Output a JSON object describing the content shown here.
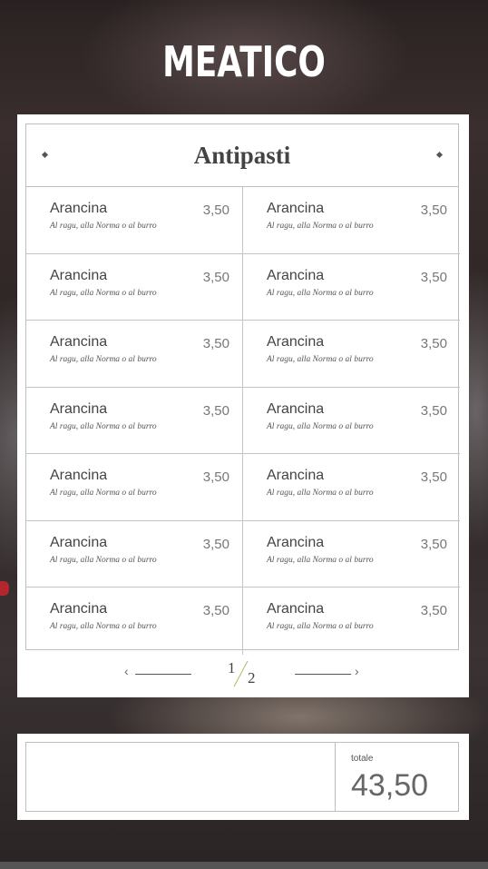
{
  "brand": {
    "logo": "MEATICO"
  },
  "menu": {
    "section_title": "Antipasti",
    "items": [
      {
        "name": "Arancina",
        "price": "3,50",
        "desc": "Al ragu, alla Norma o al burro"
      },
      {
        "name": "Arancina",
        "price": "3,50",
        "desc": "Al ragu, alla Norma o al burro"
      },
      {
        "name": "Arancina",
        "price": "3,50",
        "desc": "Al ragu, alla Norma o al burro"
      },
      {
        "name": "Arancina",
        "price": "3,50",
        "desc": "Al ragu, alla Norma o al burro"
      },
      {
        "name": "Arancina",
        "price": "3,50",
        "desc": "Al ragu, alla Norma o al burro"
      },
      {
        "name": "Arancina",
        "price": "3,50",
        "desc": "Al ragu, alla Norma o al burro"
      },
      {
        "name": "Arancina",
        "price": "3,50",
        "desc": "Al ragu, alla Norma o al burro"
      },
      {
        "name": "Arancina",
        "price": "3,50",
        "desc": "Al ragu, alla Norma o al burro"
      },
      {
        "name": "Arancina",
        "price": "3,50",
        "desc": "Al ragu, alla Norma o al burro"
      },
      {
        "name": "Arancina",
        "price": "3,50",
        "desc": "Al ragu, alla Norma o al burro"
      },
      {
        "name": "Arancina",
        "price": "3,50",
        "desc": "Al ragu, alla Norma o al burro"
      },
      {
        "name": "Arancina",
        "price": "3,50",
        "desc": "Al ragu, alla Norma o al burro"
      },
      {
        "name": "Arancina",
        "price": "3,50",
        "desc": "Al ragu, alla Norma o al burro"
      },
      {
        "name": "Arancina",
        "price": "3,50",
        "desc": "Al ragu, alla Norma o al burro"
      }
    ]
  },
  "pager": {
    "current": "1",
    "total": "2",
    "prev_icon": "‹",
    "next_icon": "›"
  },
  "order": {
    "total_label": "totale",
    "total_value": "43,50"
  },
  "icons": {
    "prev": "chevron-left-icon",
    "next": "chevron-right-icon",
    "ornament": "diamond-icon"
  },
  "colors": {
    "accent_green": "#a8c060",
    "accent_red": "#b1272d"
  }
}
